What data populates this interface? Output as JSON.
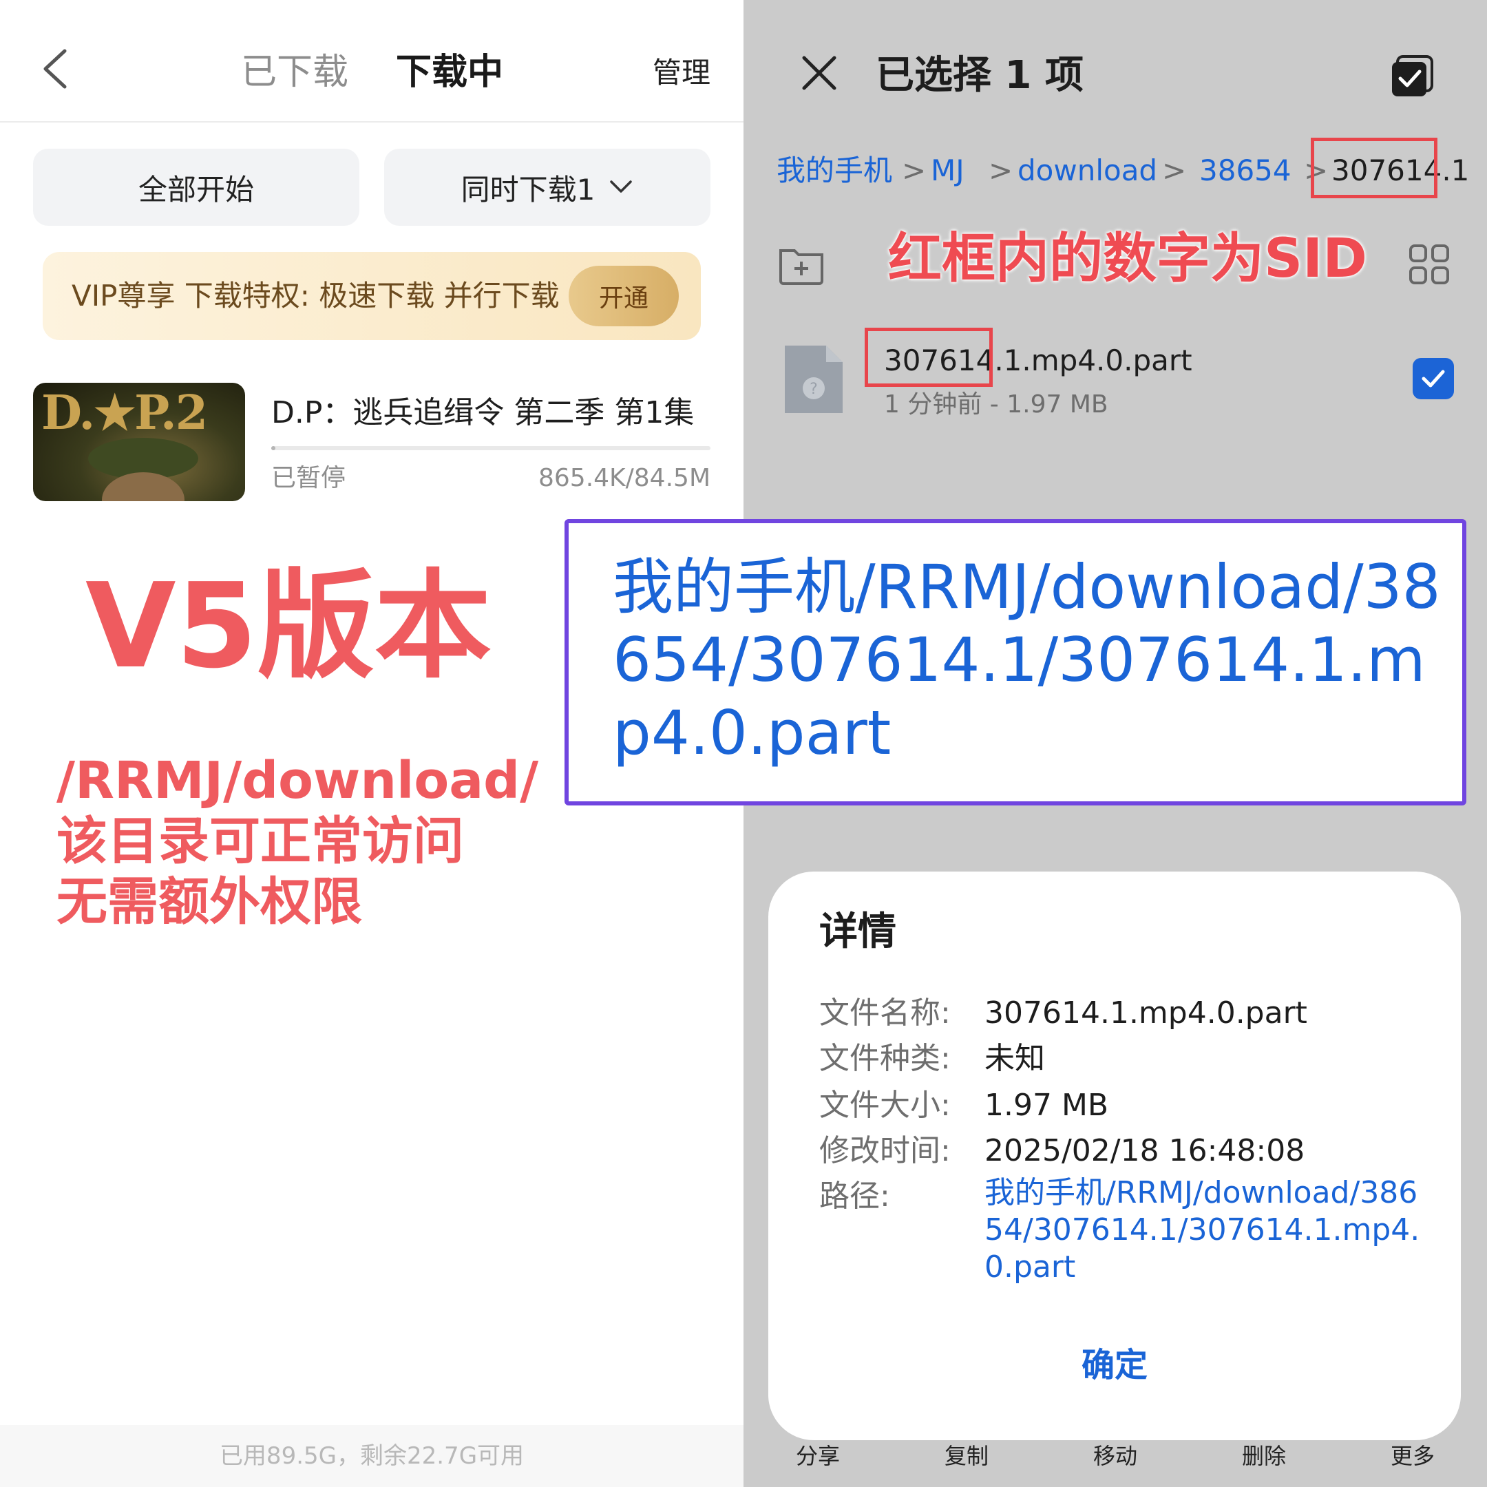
{
  "left": {
    "tabs": {
      "downloaded": "已下载",
      "downloading": "下载中"
    },
    "manage_label": "管理",
    "start_all_label": "全部开始",
    "concurrent_label": "同时下载1",
    "vip": {
      "text": "VIP尊享 下载特权: 极速下载 并行下载",
      "button": "开通"
    },
    "item": {
      "thumb_text": "D.★P.2",
      "title": "D.P：逃兵追缉令 第二季 第1集",
      "status": "已暂停",
      "size": "865.4K/84.5M",
      "progress": 0.01
    },
    "annotation": {
      "version": "V5版本",
      "lines": [
        "/RRMJ/download/",
        "该目录可正常访问",
        "无需额外权限"
      ]
    },
    "storage": "已用89.5G，剩余22.7G可用"
  },
  "right": {
    "title": "已选择 1 项",
    "breadcrumb": [
      "我的手机",
      "MJ",
      "download",
      "38654",
      "307614.1"
    ],
    "sid_note": "红框内的数字为SID",
    "file": {
      "name": "307614.1.mp4.0.part",
      "meta": "1 分钟前 - 1.97 MB"
    },
    "dialog": {
      "title": "详情",
      "rows": [
        {
          "label": "文件名称:",
          "value": "307614.1.mp4.0.part"
        },
        {
          "label": "文件种类:",
          "value": "未知"
        },
        {
          "label": "文件大小:",
          "value": "1.97 MB"
        },
        {
          "label": "修改时间:",
          "value": "2025/02/18 16:48:08"
        }
      ],
      "path_label": "路径:",
      "path_value": "我的手机/RRMJ/download/38654/307614.1/307614.1.mp4.0.part",
      "ok_label": "确定"
    },
    "bottom_bar": [
      "分享",
      "复制",
      "移动",
      "删除",
      "更多"
    ]
  },
  "overlay_path": "我的手机/RRMJ/download/38654/307614.1/307614.1.mp4.0.part",
  "colors": {
    "accent_blue": "#1a64d6",
    "annotation_red": "#ef5b5f",
    "box_purple": "#7045e0"
  }
}
